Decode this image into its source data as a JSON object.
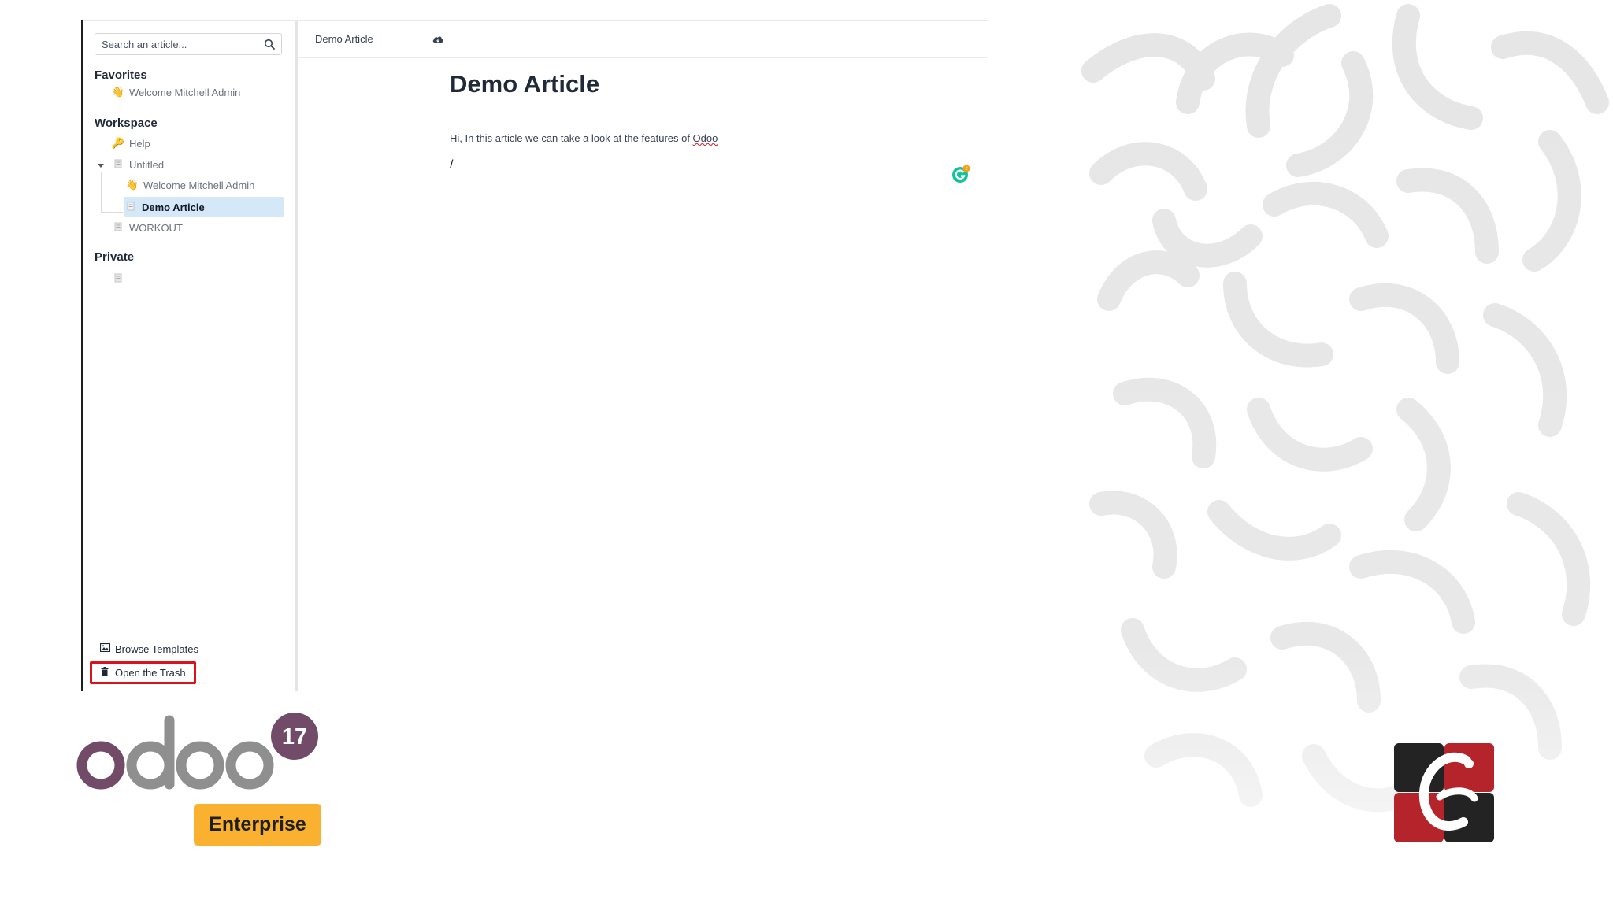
{
  "sidebar": {
    "search": {
      "placeholder": "Search an article..."
    },
    "favorites": {
      "title": "Favorites",
      "items": [
        {
          "icon": "waving-hand-icon",
          "label": "Welcome Mitchell Admin"
        }
      ]
    },
    "workspace": {
      "title": "Workspace",
      "items": [
        {
          "icon": "key-icon",
          "label": "Help"
        },
        {
          "icon": "document-icon",
          "label": "Untitled",
          "expanded": true
        },
        {
          "icon": "waving-hand-icon",
          "label": "Welcome Mitchell Admin"
        },
        {
          "icon": "document-icon",
          "label": "Demo Article",
          "active": true
        },
        {
          "icon": "document-icon",
          "label": "WORKOUT"
        }
      ]
    },
    "private": {
      "title": "Private",
      "items": [
        {
          "icon": "document-icon",
          "label": ""
        }
      ]
    },
    "bottom": {
      "browse_templates": "Browse Templates",
      "open_trash": "Open the Trash"
    }
  },
  "main": {
    "breadcrumb": "Demo Article",
    "title": "Demo Article",
    "body_prefix": "Hi, In this article we can take a look at the features of ",
    "body_link": "Odoo",
    "slash": "/",
    "grammarly_count": "2"
  },
  "branding": {
    "odoo_version": "17",
    "edition": "Enterprise",
    "colors": {
      "odoo_purple": "#714B67",
      "odoo_grey": "#8F8F8F",
      "enterprise_yellow": "#FBB130",
      "trash_highlight": "#D9121B"
    }
  }
}
